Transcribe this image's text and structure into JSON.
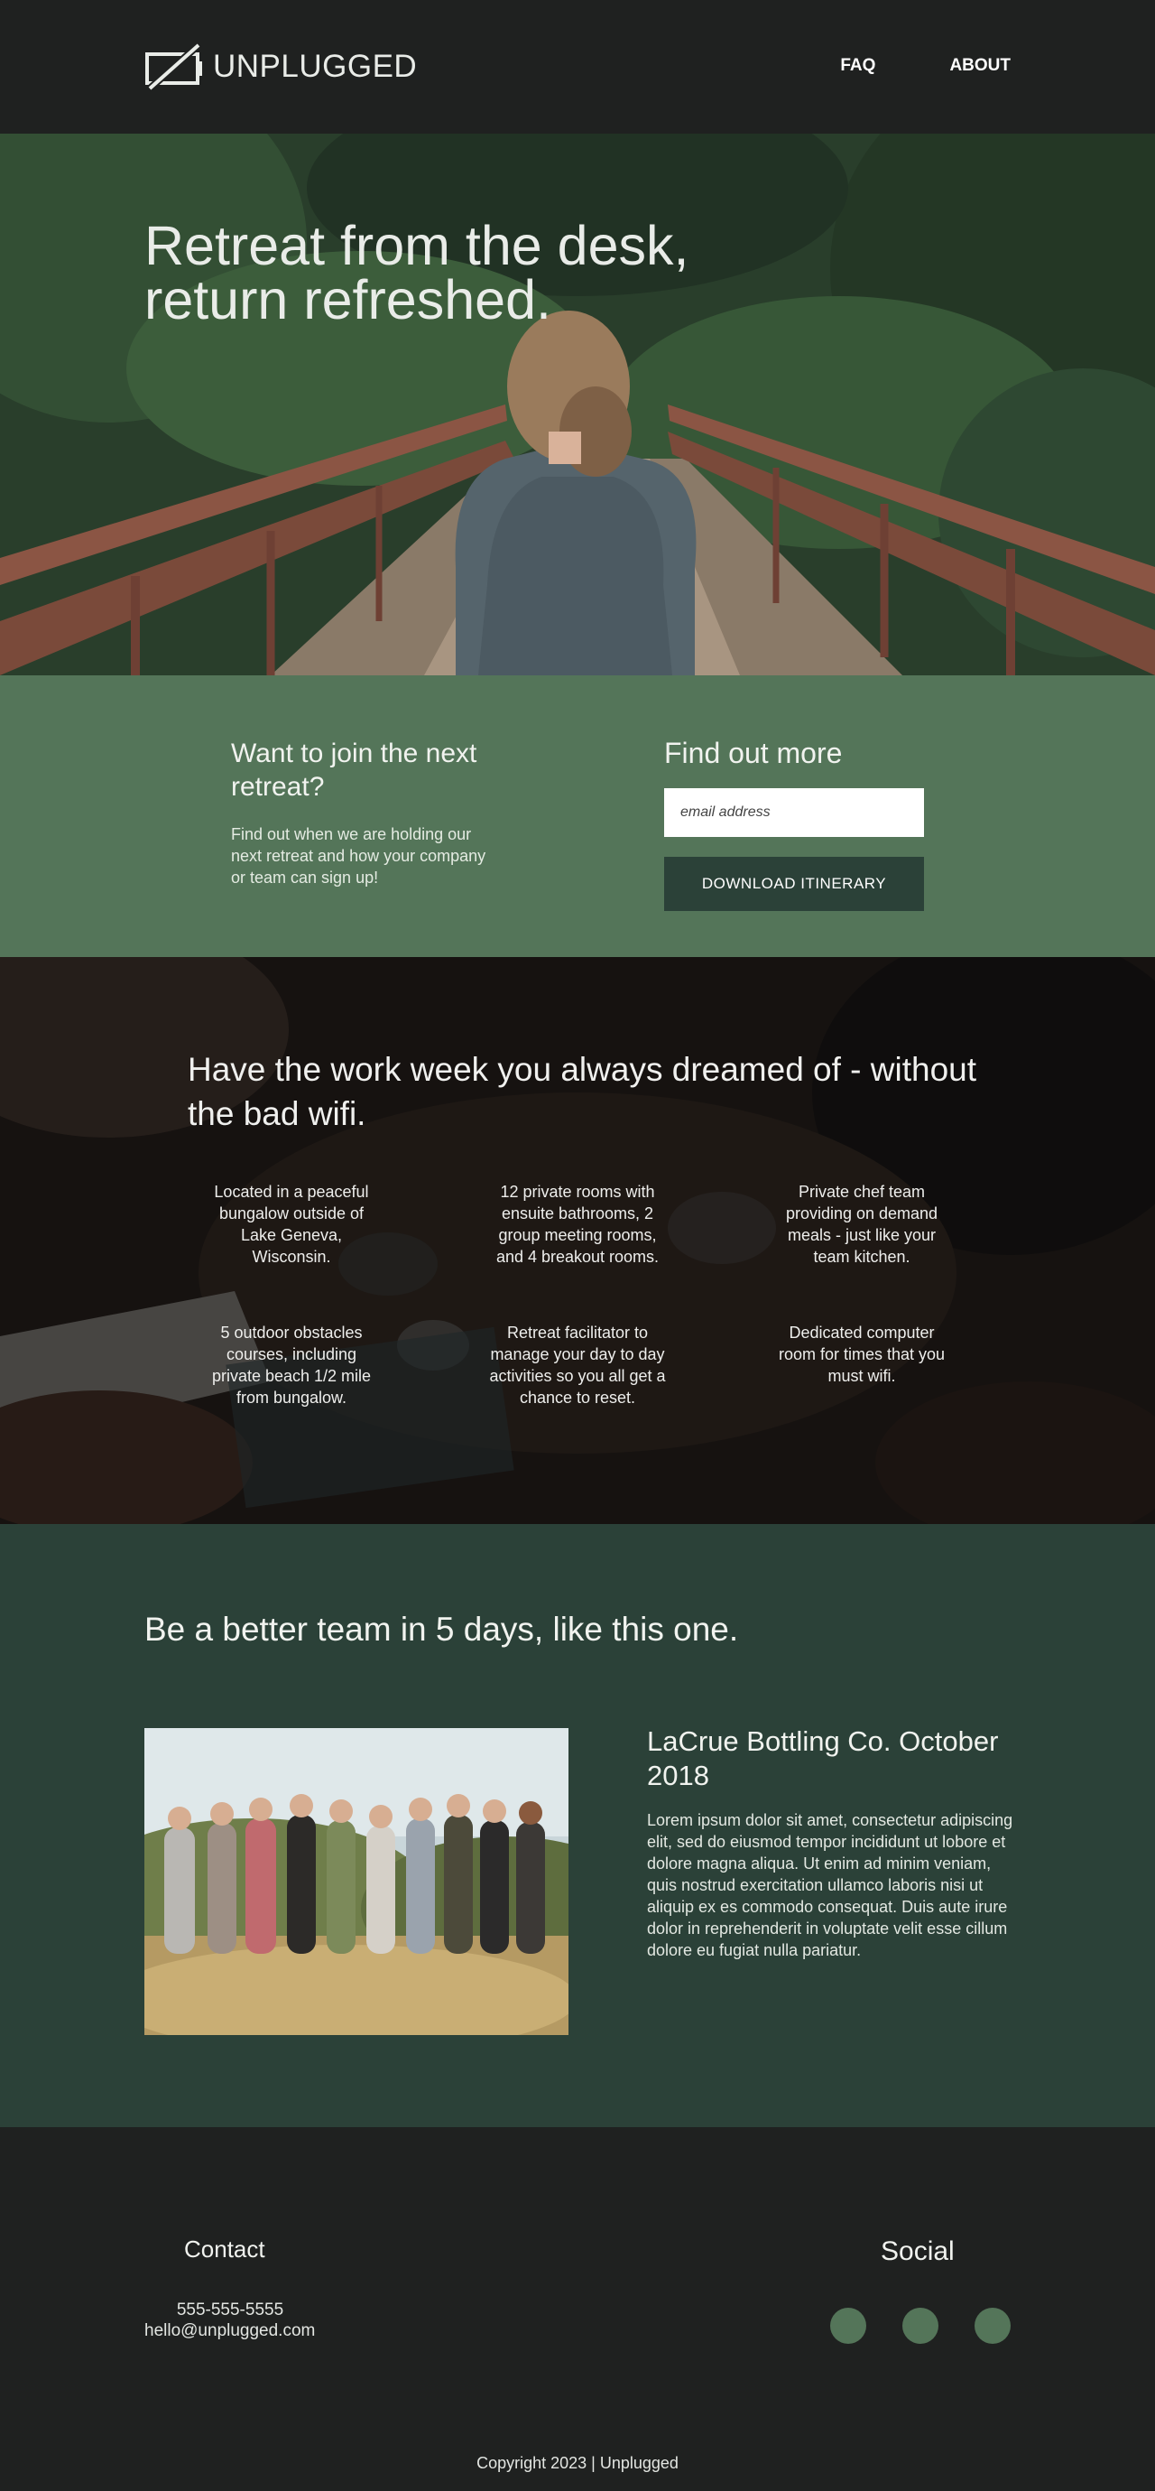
{
  "header": {
    "logo_text": "UNPLUGGED",
    "logo_icon": "battery-off-icon",
    "nav": [
      {
        "label": "FAQ"
      },
      {
        "label": "ABOUT"
      }
    ]
  },
  "hero": {
    "title": "Retreat from the desk, return refreshed."
  },
  "signup": {
    "heading": "Want to join the next retreat?",
    "text": "Find out when we are holding our next retreat and how your company or team can sign up!",
    "form_heading": "Find out more",
    "email_placeholder": "email address",
    "button_label": "DOWNLOAD ITINERARY"
  },
  "features": {
    "title": "Have the work week you always dreamed of - without the bad wifi.",
    "items": [
      "Located in a peaceful bungalow outside of Lake Geneva, Wisconsin.",
      "12 private rooms with ensuite bathrooms, 2 group meeting rooms, and 4 breakout rooms.",
      "Private chef team providing on demand meals - just like your team kitchen.",
      "5 outdoor obstacles courses, including private beach 1/2 mile from bungalow.",
      "Retreat facilitator to manage your day to day activities so you all get a chance to reset.",
      "Dedicated computer room for times that you must wifi."
    ]
  },
  "team": {
    "title": "Be a better team in 5 days, like this one.",
    "company": "LaCrue Bottling Co. October 2018",
    "description": "Lorem ipsum dolor sit amet, consectetur adipiscing elit, sed do eiusmod tempor incididunt ut lobore et dolore magna aliqua. Ut enim ad minim veniam, quis nostrud exercitation ullamco laboris nisi ut aliquip ex es commodo consequat. Duis aute irure dolor in reprehenderit in voluptate velit esse cillum dolore eu fugiat nulla pariatur."
  },
  "footer": {
    "contact_title": "Contact",
    "phone": "555-555-5555",
    "email": "hello@unplugged.com",
    "social_title": "Social",
    "copyright": "Copyright 2023 | Unplugged"
  },
  "colors": {
    "dark": "#1f2120",
    "accent_green": "#547559",
    "deep_green": "#2b4138"
  }
}
